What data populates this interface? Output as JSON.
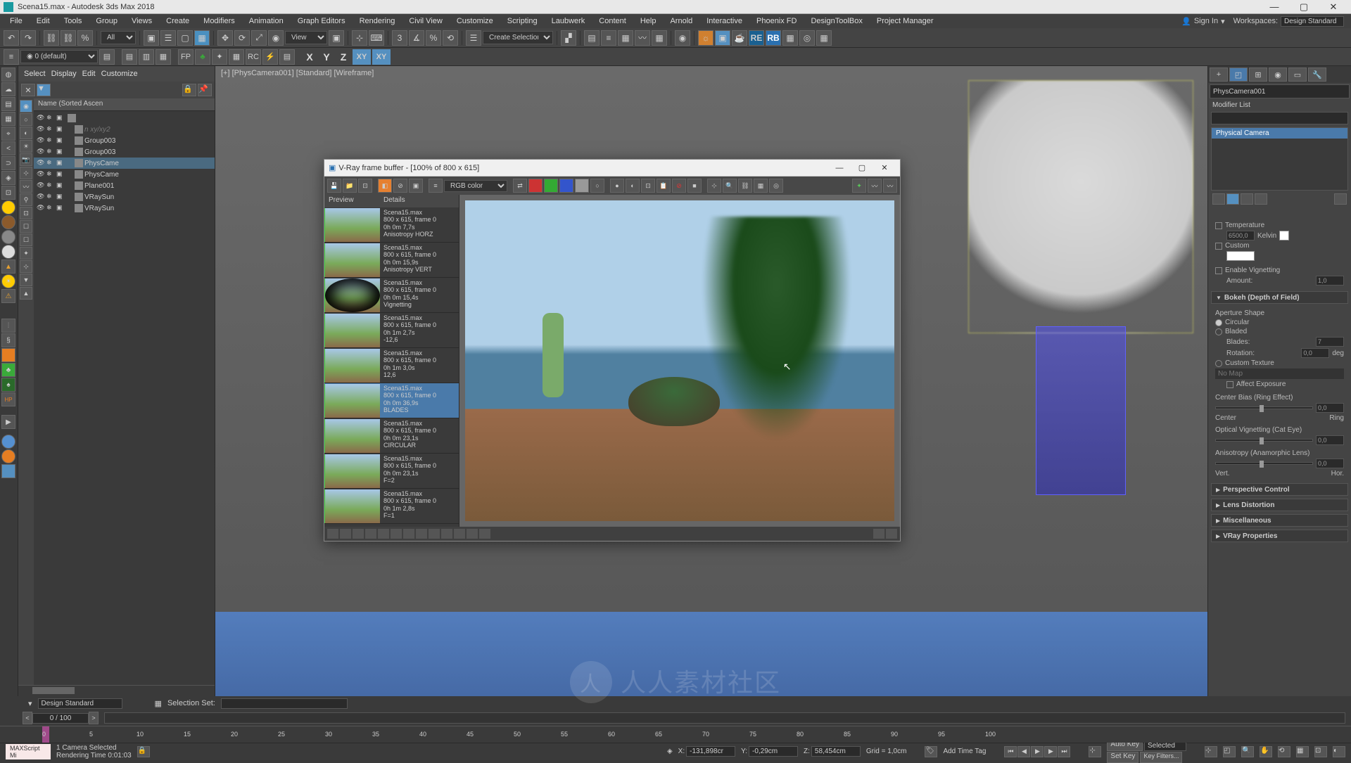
{
  "window": {
    "title": "Scena15.max - Autodesk 3ds Max 2018"
  },
  "menubar": {
    "items": [
      "File",
      "Edit",
      "Tools",
      "Group",
      "Views",
      "Create",
      "Modifiers",
      "Animation",
      "Graph Editors",
      "Rendering",
      "Civil View",
      "Customize",
      "Scripting",
      "Laubwerk",
      "Content",
      "Help",
      "Arnold",
      "Interactive",
      "Phoenix FD",
      "DesignToolBox",
      "Project Manager"
    ],
    "signin": "Sign In",
    "workspace_label": "Workspaces:",
    "workspace_value": "Design Standard"
  },
  "toolbar": {
    "filter_all": "All",
    "view": "View",
    "create_sel": "Create Selection Se",
    "fp": "FP",
    "rc": "RC",
    "re": "RE",
    "rb": "RB",
    "layer_default": "0 (default)",
    "x": "X",
    "y": "Y",
    "z": "Z",
    "xy": "XY",
    "xy2": "XY"
  },
  "scene_explorer": {
    "menus": [
      "Select",
      "Display",
      "Edit",
      "Customize"
    ],
    "header": "Name (Sorted Ascen",
    "tree": [
      {
        "label": "",
        "icon": "world",
        "indent": 0
      },
      {
        "label": "n xy/xy2",
        "icon": "grid",
        "indent": 1,
        "dim": true
      },
      {
        "label": "Group003",
        "icon": "group",
        "indent": 1
      },
      {
        "label": "Group003",
        "icon": "group",
        "indent": 1
      },
      {
        "label": "PhysCame",
        "icon": "cam",
        "indent": 1,
        "selected": true
      },
      {
        "label": "PhysCame",
        "icon": "cam",
        "indent": 1
      },
      {
        "label": "Plane001",
        "icon": "geo",
        "indent": 1
      },
      {
        "label": "VRaySun",
        "icon": "light",
        "indent": 1
      },
      {
        "label": "VRaySun",
        "icon": "light",
        "indent": 1
      }
    ]
  },
  "viewport": {
    "label": "[+] [PhysCamera001] [Standard] [Wireframe]"
  },
  "vfb": {
    "title": "V-Ray frame buffer - [100% of 800 x 615]",
    "channel": "RGB color",
    "hist_head_preview": "Preview",
    "hist_head_details": "Details",
    "history": [
      {
        "l1": "Scena15.max",
        "l2": "800 x 615, frame 0",
        "l3": "0h 0m 7,7s",
        "l4": "Anisotropy HORZ"
      },
      {
        "l1": "Scena15.max",
        "l2": "800 x 615, frame 0",
        "l3": "0h 0m 15,9s",
        "l4": "Anisotropy VERT"
      },
      {
        "l1": "Scena15.max",
        "l2": "800 x 615, frame 0",
        "l3": "0h 0m 15,4s",
        "l4": "Vignetting",
        "vignette": true
      },
      {
        "l1": "Scena15.max",
        "l2": "800 x 615, frame 0",
        "l3": "0h 1m 2,7s",
        "l4": "-12,6"
      },
      {
        "l1": "Scena15.max",
        "l2": "800 x 615, frame 0",
        "l3": "0h 1m 3,0s",
        "l4": "12,6"
      },
      {
        "l1": "Scena15.max",
        "l2": "800 x 615, frame 0",
        "l3": "0h 0m 36,9s",
        "l4": "BLADES",
        "selected": true
      },
      {
        "l1": "Scena15.max",
        "l2": "800 x 615, frame 0",
        "l3": "0h 0m 23,1s",
        "l4": "CIRCULAR"
      },
      {
        "l1": "Scena15.max",
        "l2": "800 x 615, frame 0",
        "l3": "0h 0m 23,1s",
        "l4": "F=2"
      },
      {
        "l1": "Scena15.max",
        "l2": "800 x 615, frame 0",
        "l3": "0h 1m 2,8s",
        "l4": "F=1"
      }
    ]
  },
  "right_panel": {
    "name": "PhysCamera001",
    "modlist_label": "Modifier List",
    "stack_item": "Physical Camera",
    "temperature_label": "Temperature",
    "temp_value": "6500,0",
    "temp_unit": "Kelvin",
    "custom_label": "Custom",
    "vignetting_label": "Enable Vignetting",
    "amount_label": "Amount:",
    "amount_value": "1,0",
    "bokeh_head": "Bokeh (Depth of Field)",
    "aperture_shape": "Aperture Shape",
    "circular": "Circular",
    "bladed": "Bladed",
    "blades_label": "Blades:",
    "blades_value": "7",
    "rotation_label": "Rotation:",
    "rotation_value": "0,0",
    "rotation_unit": "deg",
    "custom_texture": "Custom Texture",
    "no_map": "No Map",
    "affect_exposure": "Affect Exposure",
    "center_bias_label": "Center Bias (Ring Effect)",
    "center_bias_value": "0,0",
    "center": "Center",
    "ring": "Ring",
    "optical_vignetting": "Optical Vignetting (Cat Eye)",
    "opt_vig_value": "0,0",
    "anisotropy_label": "Anisotropy (Anamorphic Lens)",
    "aniso_value": "0,0",
    "vert": "Vert.",
    "hor": "Hor.",
    "perspective": "Perspective Control",
    "lens_distortion": "Lens Distortion",
    "misc": "Miscellaneous",
    "vray_props": "VRay Properties"
  },
  "design_bar": {
    "design": "Design Standard",
    "selection_set": "Selection Set:"
  },
  "timeline": {
    "frame": "0 / 100",
    "ticks": [
      0,
      5,
      10,
      15,
      20,
      25,
      30,
      35,
      40,
      45,
      50,
      55,
      60,
      65,
      70,
      75,
      80,
      85,
      90,
      95,
      100
    ]
  },
  "status": {
    "selected": "1 Camera Selected",
    "rendering_time": "Rendering Time 0:01:03",
    "maxscript": "MAXScript Mi",
    "x_label": "X:",
    "x_value": "-131,898cr",
    "y_label": "Y:",
    "y_value": "-0,29cm",
    "z_label": "Z:",
    "z_value": "58,454cm",
    "grid": "Grid = 1,0cm",
    "autokey": "Auto Key",
    "selected_mode": "Selected",
    "setkey": "Set Key",
    "keyfilters": "Key Filters...",
    "add_time_tag": "Add Time Tag"
  },
  "watermark": "人人素材社区"
}
